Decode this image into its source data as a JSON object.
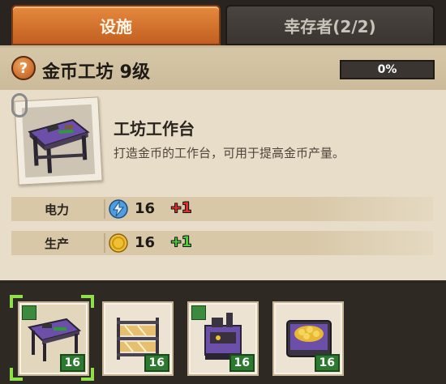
{
  "tabs": {
    "facilities": "设施",
    "survivors": "幸存者(2/2)"
  },
  "header": {
    "help_symbol": "?",
    "title": "金币工坊 9级",
    "progress_text": "0%",
    "progress_value": 0
  },
  "item": {
    "name": "工坊工作台",
    "description": "打造金币的工作台，可用于提高金币产量。"
  },
  "stats": [
    {
      "label": "电力",
      "icon": "lightning-icon",
      "value": "16",
      "delta": "+1",
      "delta_color": "#e0302a"
    },
    {
      "label": "生产",
      "icon": "coin-icon",
      "value": "16",
      "delta": "+1",
      "delta_color": "#4ccc3a"
    }
  ],
  "slots": [
    {
      "icon": "workbench-icon",
      "level": "16",
      "assigned": true,
      "selected": true
    },
    {
      "icon": "gold-shelf-icon",
      "level": "16",
      "assigned": false,
      "selected": false
    },
    {
      "icon": "coin-press-machine-icon",
      "level": "16",
      "assigned": true,
      "selected": false
    },
    {
      "icon": "coin-chest-icon",
      "level": "16",
      "assigned": false,
      "selected": false
    }
  ],
  "colors": {
    "tab_active": "#d9772f",
    "level_badge": "#2c7a30",
    "selection_corner": "#8ee04a"
  }
}
